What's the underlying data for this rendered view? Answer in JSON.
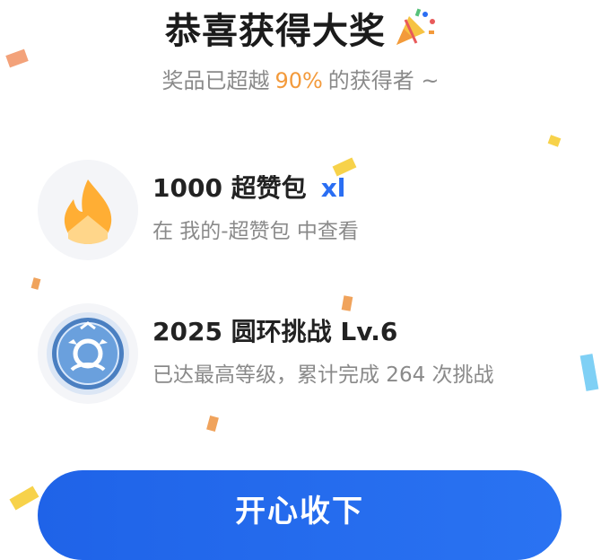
{
  "dialog": {
    "title": "恭喜获得大奖",
    "subtitle_prefix": "奖品已超越",
    "subtitle_percent": "90%",
    "subtitle_suffix": "的获得者 ~"
  },
  "rewards": [
    {
      "name": "1000 超赞包",
      "tag": "xl",
      "description": "在 我的-超赞包 中查看",
      "icon": "flame-icon"
    },
    {
      "name": "2025 圆环挑战 Lv.6",
      "description": "已达最高等级，累计完成 264 次挑战",
      "icon": "ring-medal-icon"
    }
  ],
  "button": {
    "label": "开心收下"
  },
  "colors": {
    "accent_blue": "#2a6ef3",
    "highlight_orange": "#f39a3b",
    "muted_text": "#8a8a8a"
  }
}
